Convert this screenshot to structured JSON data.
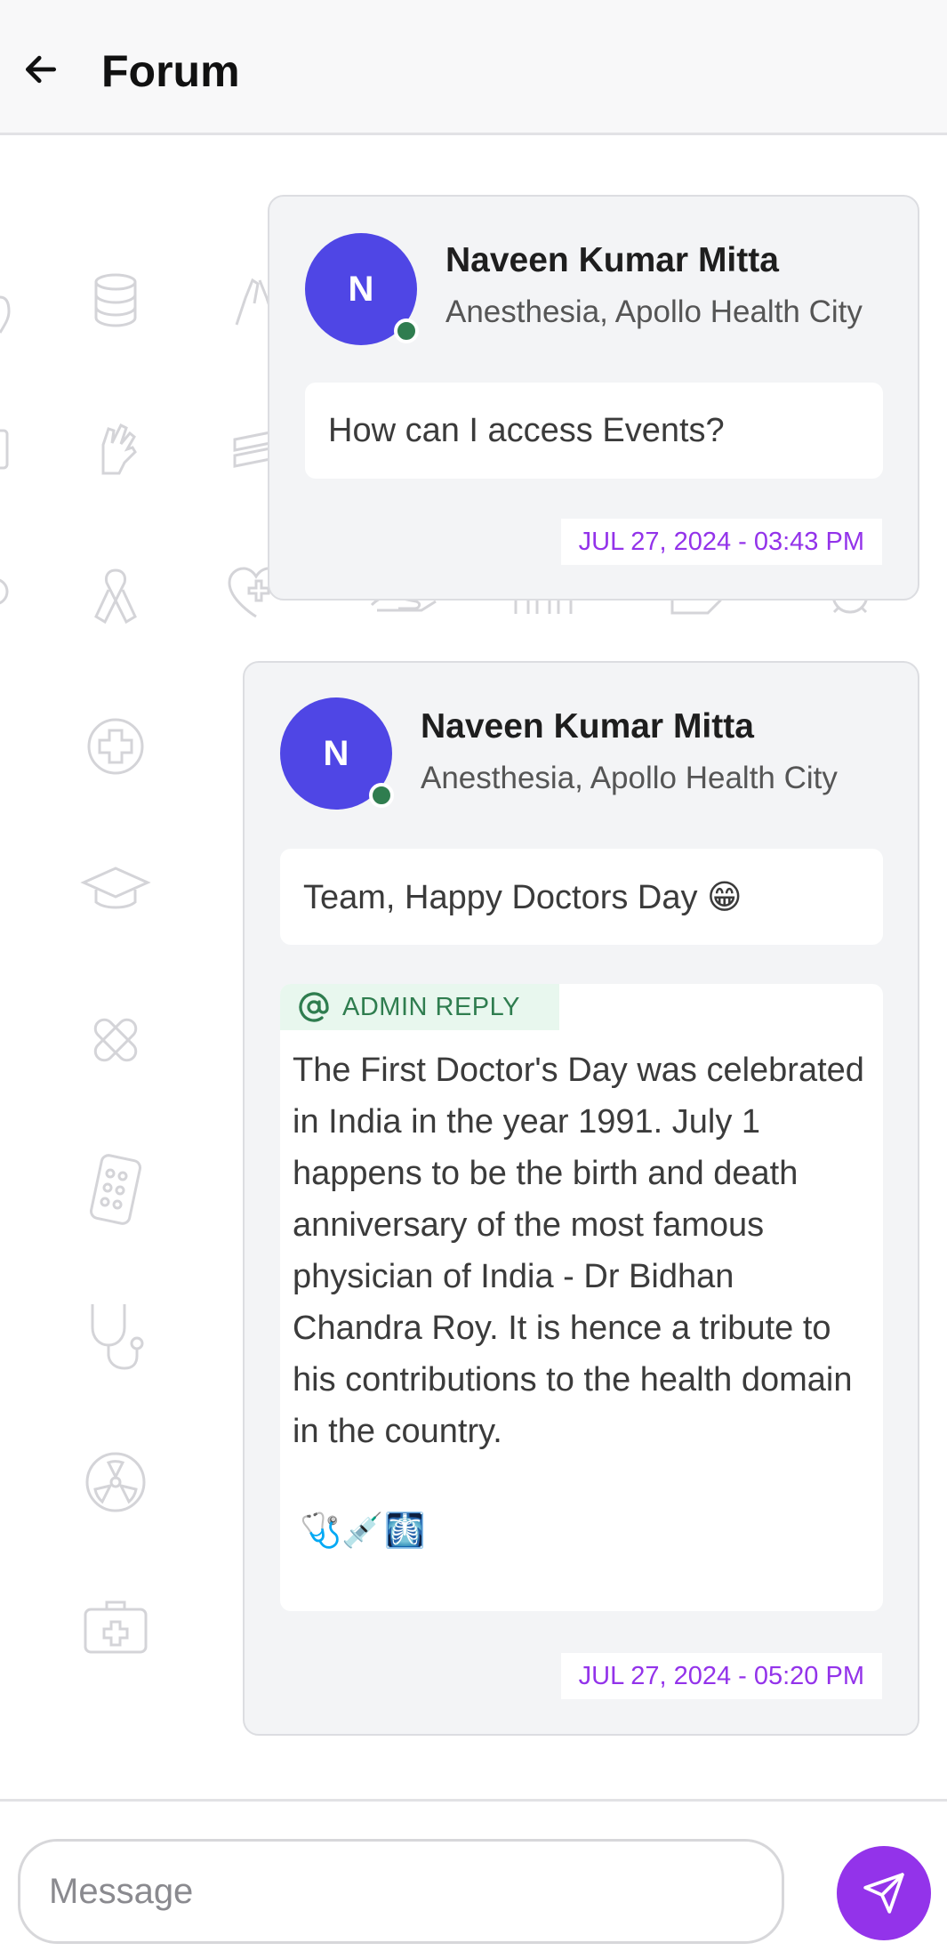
{
  "header": {
    "title": "Forum",
    "back_icon": "arrow-left-icon"
  },
  "messages": [
    {
      "avatar_initial": "N",
      "author": "Naveen Kumar Mitta",
      "role": "Anesthesia, Apollo Health City",
      "text": "How can I access Events?",
      "timestamp": "JUL 27, 2024 - 03:43 PM",
      "online": true
    },
    {
      "avatar_initial": "N",
      "author": "Naveen Kumar Mitta",
      "role": "Anesthesia, Apollo Health City",
      "text": "Team, Happy Doctors Day 😁",
      "timestamp": "JUL 27, 2024 - 05:20 PM",
      "online": true,
      "admin_reply": {
        "label": "ADMIN REPLY",
        "text": "The First Doctor's Day was celebrated in India in the year 1991. July 1 happens to be the birth and death anniversary of the most famous physician of India - Dr Bidhan Chandra Roy. It is hence a tribute to his contributions to the health domain in the country.",
        "emojis": "🩺💉🩻"
      }
    }
  ],
  "composer": {
    "placeholder": "Message",
    "send_icon": "send-icon"
  },
  "colors": {
    "accent": "#9333ea",
    "avatar": "#4f46e5",
    "online": "#2f7d4f",
    "admin_tag_bg": "#e8f7ee"
  }
}
